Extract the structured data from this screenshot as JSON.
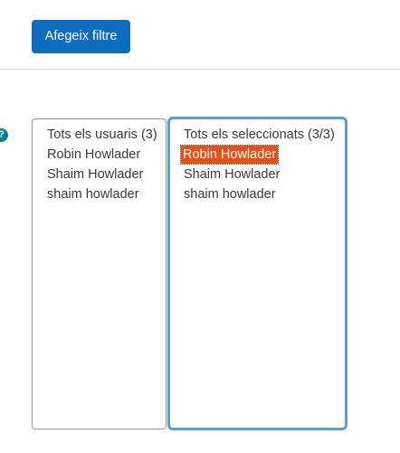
{
  "toolbar": {
    "add_filter_label": "Afegeix filtre"
  },
  "help": {
    "glyph": "?"
  },
  "available_users": {
    "options": [
      "Tots els usuaris (3)",
      "Robin Howlader",
      "Shaim Howlader",
      "shaim howlader"
    ]
  },
  "selected_users": {
    "options": [
      "Tots els seleccionats (3/3)",
      "Robin Howlader",
      "Shaim Howlader",
      "shaim howlader"
    ],
    "highlighted_option": "Robin Howlader"
  },
  "colors": {
    "primary": "#0f6cbf",
    "help_icon": "#008196",
    "highlight": "#e8501a",
    "focus_border": "#5d9cd8"
  }
}
